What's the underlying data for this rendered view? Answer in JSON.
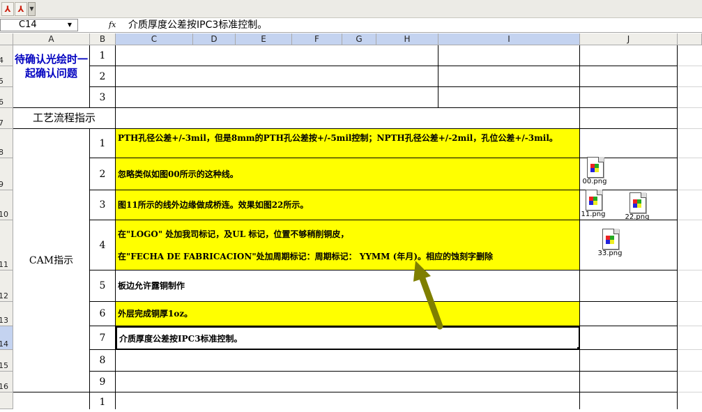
{
  "namebox": {
    "value": "C14"
  },
  "formula_bar": {
    "fx_label": "fx",
    "value": "介质厚度公差按IPC3标准控制。"
  },
  "columns": [
    "A",
    "B",
    "C",
    "D",
    "E",
    "F",
    "G",
    "H",
    "I",
    "J"
  ],
  "rows": [
    "4",
    "5",
    "6",
    "7",
    "8",
    "9",
    "10",
    "11",
    "12",
    "13",
    "14",
    "15",
    "16"
  ],
  "sheet": {
    "section1_title": "待确认光绘时一起确认问题",
    "section1_nums": [
      "1",
      "2",
      "3"
    ],
    "process_title": "工艺流程指示",
    "cam_title": "CAM指示",
    "cam_items": [
      {
        "num": "1",
        "text": "PTH孔径公差+/-3mil，但是8mm的PTH孔公差按+/-5mil控制；NPTH孔径公差+/-2mil，孔位公差+/-3mil。"
      },
      {
        "num": "2",
        "text": "忽略类似如图00所示的这种线。"
      },
      {
        "num": "3",
        "text": "图11所示的线外边缘做成桥连。效果如图22所示。"
      },
      {
        "num": "4",
        "line1": "在\"LOGO\" 处加我司标记，及UL 标记，位置不够稍削铜皮，",
        "line2": "在\"FECHA DE FABRICACION\"处加周期标记：周期标记：  YYMM (年月)。相应的蚀刻字删除"
      },
      {
        "num": "5",
        "text": "板边允许露铜制作"
      },
      {
        "num": "6",
        "text": "外层完成铜厚1oz。"
      },
      {
        "num": "7",
        "text": "介质厚度公差按IPC3标准控制。"
      },
      {
        "num": "8",
        "text": ""
      },
      {
        "num": "9",
        "text": ""
      }
    ],
    "last_num": "1"
  },
  "attachments": [
    "00.png",
    "11.png",
    "22.png",
    "33.png"
  ],
  "colors": {
    "highlight": "#ffff00",
    "title_blue": "#0000c0",
    "arrow": "#7f7f00",
    "selection": "#c4d3f0"
  }
}
